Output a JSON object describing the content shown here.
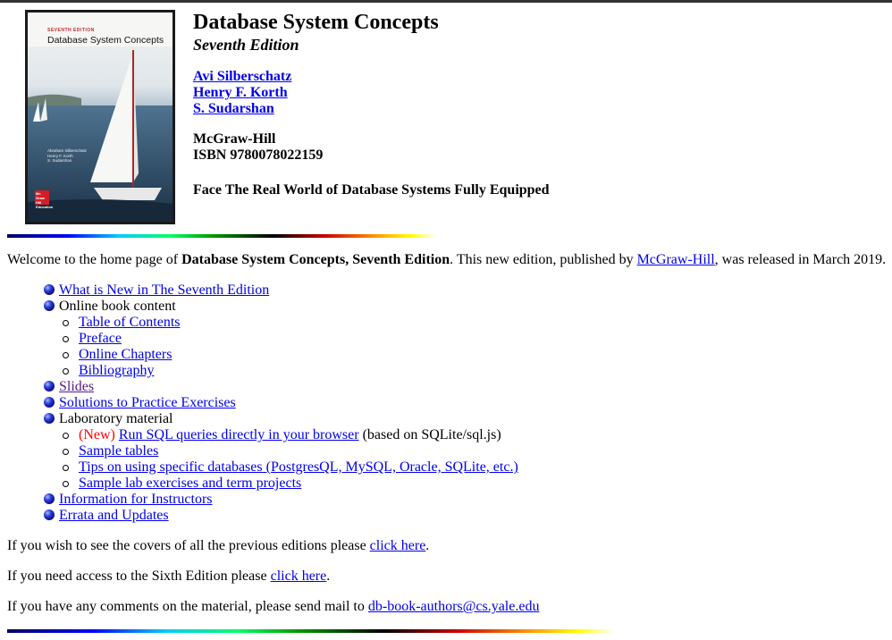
{
  "cover": {
    "edition_label": "SEVENTH EDITION",
    "title": "Database System Concepts",
    "authors": [
      "Abraham Silberschatz",
      "Henry F. Korth",
      "S. Sudarshan"
    ],
    "publisher_logo": "Mc Graw Hill Education"
  },
  "header": {
    "title": "Database System Concepts",
    "edition": "Seventh Edition",
    "authors": [
      "Avi Silberschatz",
      "Henry F. Korth",
      "S. Sudarshan"
    ],
    "publisher": "McGraw-Hill",
    "isbn": "ISBN 9780078022159",
    "tagline": "Face The Real World of Database Systems Fully Equipped"
  },
  "welcome": {
    "prefix": "Welcome to the home page of ",
    "book": "Database System Concepts, Seventh Edition",
    "middle": ". This new edition, published by ",
    "publisher_link": "McGraw-Hill",
    "suffix": ", was released in March 2019."
  },
  "menu": {
    "whats_new": "What is New in The Seventh Edition",
    "online_content": "Online book content",
    "online_items": [
      "Table of Contents",
      "Preface",
      "Online Chapters",
      "Bibliography"
    ],
    "slides": "Slides",
    "solutions": "Solutions to Practice Exercises",
    "lab": "Laboratory material",
    "lab_new_tag": "(New)",
    "lab_sql_link": "Run SQL queries directly in your browser",
    "lab_sql_note": " (based on SQLite/sql.js)",
    "lab_items": [
      "Sample tables",
      "Tips on using specific databases (PostgresQL, MySQL, Oracle, SQLite, etc.)",
      "Sample lab exercises and term projects"
    ],
    "instructors": "Information for Instructors",
    "errata": "Errata and Updates"
  },
  "footer": {
    "covers_text": "If you wish to see the covers of all the previous editions please ",
    "covers_link": "click here",
    "sixth_text": "If you need access to the Sixth Edition please ",
    "sixth_link": "click here",
    "mail_text": "If you have any comments on the material, please send mail to ",
    "mail_link": "db-book-authors@cs.yale.edu",
    "period": "."
  }
}
